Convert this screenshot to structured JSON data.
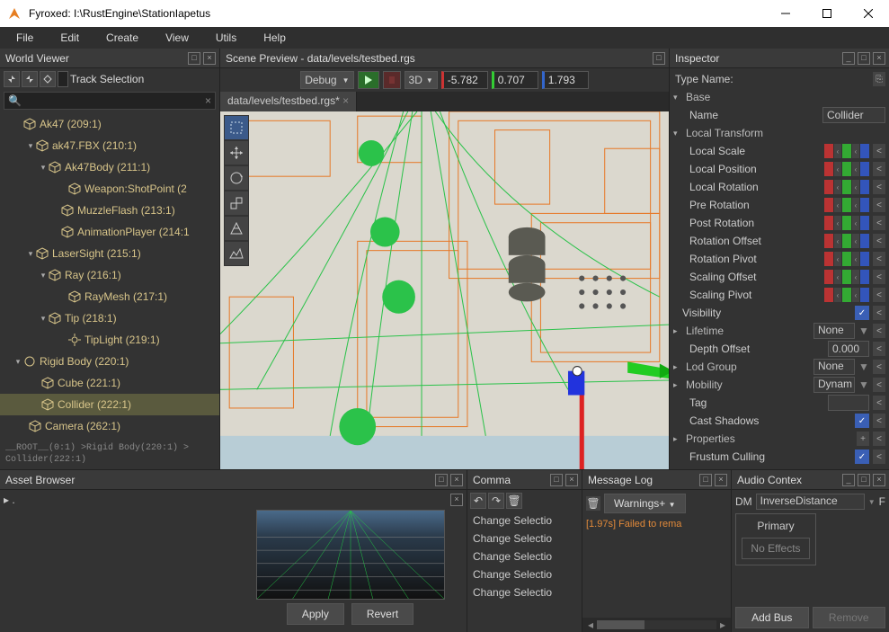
{
  "window": {
    "title": "Fyroxed: I:\\RustEngine\\StationIapetus"
  },
  "menu": [
    "File",
    "Edit",
    "Create",
    "View",
    "Utils",
    "Help"
  ],
  "world_viewer": {
    "title": "World Viewer",
    "track_selection": "Track Selection",
    "tree": [
      {
        "pad": 14,
        "arrow": "",
        "icon": "cube",
        "label": "Ak47 (209:1)"
      },
      {
        "pad": 28,
        "arrow": "▾",
        "icon": "cube",
        "label": "ak47.FBX (210:1)"
      },
      {
        "pad": 42,
        "arrow": "▾",
        "icon": "cube",
        "label": "Ak47Body (211:1)"
      },
      {
        "pad": 64,
        "arrow": "",
        "icon": "cube",
        "label": "Weapon:ShotPoint (2"
      },
      {
        "pad": 56,
        "arrow": "",
        "icon": "cube",
        "label": "MuzzleFlash (213:1)"
      },
      {
        "pad": 56,
        "arrow": "",
        "icon": "cube",
        "label": "AnimationPlayer (214:1"
      },
      {
        "pad": 28,
        "arrow": "▾",
        "icon": "cube",
        "label": "LaserSight (215:1)"
      },
      {
        "pad": 42,
        "arrow": "▾",
        "icon": "cube",
        "label": "Ray (216:1)"
      },
      {
        "pad": 64,
        "arrow": "",
        "icon": "cube",
        "label": "RayMesh (217:1)"
      },
      {
        "pad": 42,
        "arrow": "▾",
        "icon": "cube",
        "label": "Tip (218:1)"
      },
      {
        "pad": 64,
        "arrow": "",
        "icon": "light",
        "label": "TipLight (219:1)"
      },
      {
        "pad": 14,
        "arrow": "▾",
        "icon": "sphere",
        "label": "Rigid Body (220:1)"
      },
      {
        "pad": 34,
        "arrow": "",
        "icon": "cube",
        "label": "Cube (221:1)"
      },
      {
        "pad": 34,
        "arrow": "",
        "icon": "cube",
        "label": "Collider (222:1)",
        "sel": true
      },
      {
        "pad": 20,
        "arrow": "",
        "icon": "cube",
        "label": "Camera (262:1)"
      }
    ],
    "breadcrumb": "__ROOT__(0:1) >Rigid Body(220:1) > Collider(222:1)"
  },
  "scene": {
    "title": "Scene Preview - data/levels/testbed.rgs",
    "mode": "Debug",
    "threeD": "3D",
    "x": "-5.782",
    "y": "0.707",
    "z": "1.793",
    "tab": "data/levels/testbed.rgs*"
  },
  "inspector": {
    "title": "Inspector",
    "type_name_label": "Type Name:",
    "groups": {
      "base": "Base",
      "name_label": "Name",
      "name_value": "Collider",
      "local_transform": "Local Transform",
      "local_scale": "Local Scale",
      "local_position": "Local Position",
      "local_rotation": "Local Rotation",
      "pre_rotation": "Pre Rotation",
      "post_rotation": "Post Rotation",
      "rotation_offset": "Rotation Offset",
      "rotation_pivot": "Rotation Pivot",
      "scaling_offset": "Scaling Offset",
      "scaling_pivot": "Scaling Pivot",
      "visibility": "Visibility",
      "lifetime": "Lifetime",
      "lifetime_value": "None",
      "depth_offset": "Depth Offset",
      "depth_offset_value": "0.000",
      "lod_group": "Lod Group",
      "lod_group_value": "None",
      "mobility": "Mobility",
      "mobility_value": "Dynam",
      "tag": "Tag",
      "cast_shadows": "Cast Shadows",
      "properties": "Properties",
      "frustum_culling": "Frustum Culling"
    }
  },
  "asset_browser": {
    "title": "Asset Browser",
    "apply": "Apply",
    "revert": "Revert",
    "root": "▸ ."
  },
  "command_stack": {
    "title": "Comma",
    "items": [
      "Change Selectio",
      "Change Selectio",
      "Change Selectio",
      "Change Selectio",
      "Change Selectio"
    ]
  },
  "message_log": {
    "title": "Message Log",
    "filter": "Warnings+",
    "line": "[1.97s] Failed to rema"
  },
  "audio": {
    "title": "Audio Contex",
    "dm": "DM",
    "renderer": "InverseDistance",
    "primary": "Primary",
    "no_effects": "No Effects",
    "add_bus": "Add Bus",
    "remove": "Remove"
  }
}
